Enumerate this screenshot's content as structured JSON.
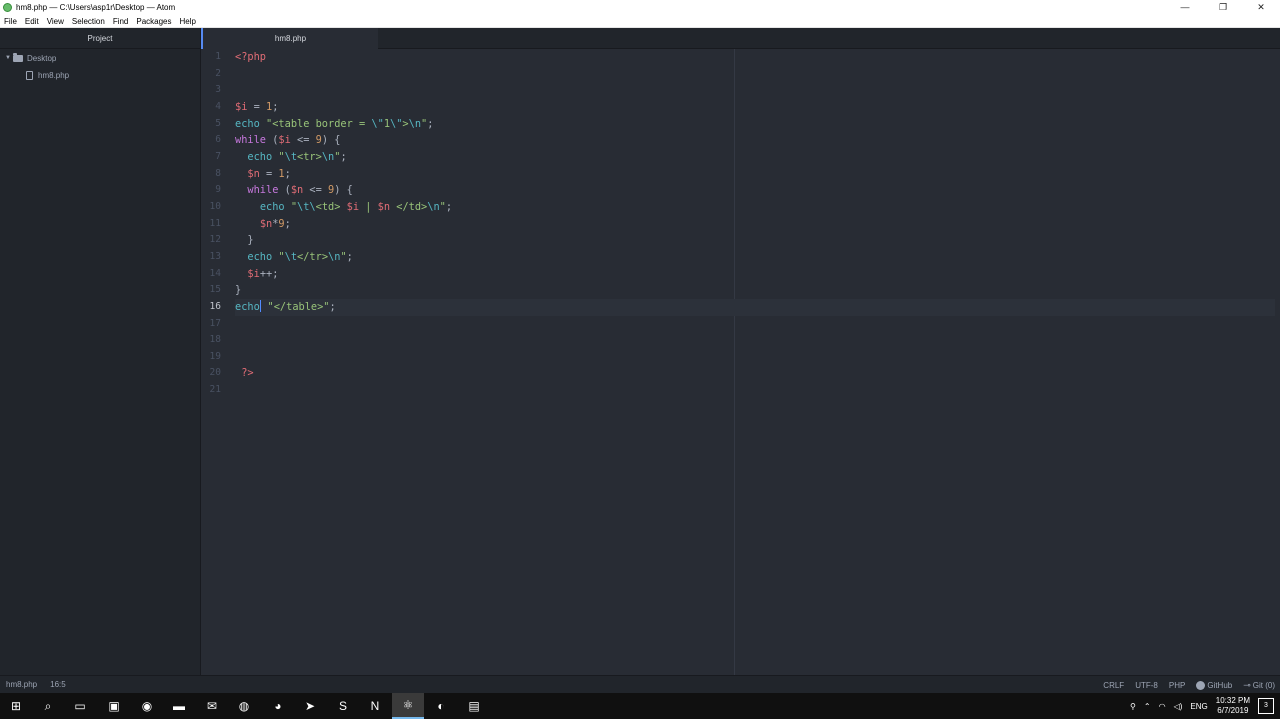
{
  "window": {
    "title": "hm8.php — C:\\Users\\asp1r\\Desktop — Atom",
    "controls": [
      "—",
      "❐",
      "✕"
    ]
  },
  "menu": [
    "File",
    "Edit",
    "View",
    "Selection",
    "Find",
    "Packages",
    "Help"
  ],
  "tree": {
    "header": "Project",
    "folder": "Desktop",
    "file": "hm8.php"
  },
  "tabs": [
    {
      "label": "hm8.php"
    }
  ],
  "editor": {
    "current_line": 16,
    "lines": [
      {
        "n": "1"
      },
      {
        "n": "2"
      },
      {
        "n": "3"
      },
      {
        "n": "4"
      },
      {
        "n": "5"
      },
      {
        "n": "6"
      },
      {
        "n": "7"
      },
      {
        "n": "8"
      },
      {
        "n": "9"
      },
      {
        "n": "10"
      },
      {
        "n": "11"
      },
      {
        "n": "12"
      },
      {
        "n": "13"
      },
      {
        "n": "14"
      },
      {
        "n": "15"
      },
      {
        "n": "16"
      },
      {
        "n": "17"
      },
      {
        "n": "18"
      },
      {
        "n": "19"
      },
      {
        "n": "20"
      },
      {
        "n": "21"
      }
    ],
    "code": [
      [
        {
          "t": "<?php",
          "c": "#e06c75"
        }
      ],
      [],
      [],
      [
        {
          "t": "$i",
          "c": "#e06c75"
        },
        {
          "t": " = ",
          "c": "#abb2bf"
        },
        {
          "t": "1",
          "c": "#d19a66"
        },
        {
          "t": ";",
          "c": "#abb2bf"
        }
      ],
      [
        {
          "t": "echo",
          "c": "#56b6c2"
        },
        {
          "t": " ",
          "c": "#abb2bf"
        },
        {
          "t": "\"<table border = ",
          "c": "#98c379"
        },
        {
          "t": "\\\"",
          "c": "#56b6c2"
        },
        {
          "t": "1",
          "c": "#98c379"
        },
        {
          "t": "\\\"",
          "c": "#56b6c2"
        },
        {
          "t": ">",
          "c": "#98c379"
        },
        {
          "t": "\\n",
          "c": "#56b6c2"
        },
        {
          "t": "\"",
          "c": "#98c379"
        },
        {
          "t": ";",
          "c": "#abb2bf"
        }
      ],
      [
        {
          "t": "while",
          "c": "#c678dd"
        },
        {
          "t": " (",
          "c": "#abb2bf"
        },
        {
          "t": "$i",
          "c": "#e06c75"
        },
        {
          "t": " <= ",
          "c": "#abb2bf"
        },
        {
          "t": "9",
          "c": "#d19a66"
        },
        {
          "t": ") {",
          "c": "#abb2bf"
        }
      ],
      [
        {
          "t": "  ",
          "c": "#abb2bf"
        },
        {
          "t": "echo",
          "c": "#56b6c2"
        },
        {
          "t": " ",
          "c": "#abb2bf"
        },
        {
          "t": "\"",
          "c": "#98c379"
        },
        {
          "t": "\\t",
          "c": "#56b6c2"
        },
        {
          "t": "<tr>",
          "c": "#98c379"
        },
        {
          "t": "\\n",
          "c": "#56b6c2"
        },
        {
          "t": "\"",
          "c": "#98c379"
        },
        {
          "t": ";",
          "c": "#abb2bf"
        }
      ],
      [
        {
          "t": "  ",
          "c": "#abb2bf"
        },
        {
          "t": "$n",
          "c": "#e06c75"
        },
        {
          "t": " = ",
          "c": "#abb2bf"
        },
        {
          "t": "1",
          "c": "#d19a66"
        },
        {
          "t": ";",
          "c": "#abb2bf"
        }
      ],
      [
        {
          "t": "  ",
          "c": "#abb2bf"
        },
        {
          "t": "while",
          "c": "#c678dd"
        },
        {
          "t": " (",
          "c": "#abb2bf"
        },
        {
          "t": "$n",
          "c": "#e06c75"
        },
        {
          "t": " <= ",
          "c": "#abb2bf"
        },
        {
          "t": "9",
          "c": "#d19a66"
        },
        {
          "t": ") {",
          "c": "#abb2bf"
        }
      ],
      [
        {
          "t": "    ",
          "c": "#abb2bf"
        },
        {
          "t": "echo",
          "c": "#56b6c2"
        },
        {
          "t": " ",
          "c": "#abb2bf"
        },
        {
          "t": "\"",
          "c": "#98c379"
        },
        {
          "t": "\\t\\",
          "c": "#56b6c2"
        },
        {
          "t": "<td> ",
          "c": "#98c379"
        },
        {
          "t": "$i",
          "c": "#e06c75"
        },
        {
          "t": " | ",
          "c": "#98c379"
        },
        {
          "t": "$n",
          "c": "#e06c75"
        },
        {
          "t": " </td>",
          "c": "#98c379"
        },
        {
          "t": "\\n",
          "c": "#56b6c2"
        },
        {
          "t": "\"",
          "c": "#98c379"
        },
        {
          "t": ";",
          "c": "#abb2bf"
        }
      ],
      [
        {
          "t": "    ",
          "c": "#abb2bf"
        },
        {
          "t": "$n",
          "c": "#e06c75"
        },
        {
          "t": "*",
          "c": "#abb2bf"
        },
        {
          "t": "9",
          "c": "#d19a66"
        },
        {
          "t": ";",
          "c": "#abb2bf"
        }
      ],
      [
        {
          "t": "  }",
          "c": "#abb2bf"
        }
      ],
      [
        {
          "t": "  ",
          "c": "#abb2bf"
        },
        {
          "t": "echo",
          "c": "#56b6c2"
        },
        {
          "t": " ",
          "c": "#abb2bf"
        },
        {
          "t": "\"",
          "c": "#98c379"
        },
        {
          "t": "\\t",
          "c": "#56b6c2"
        },
        {
          "t": "</tr>",
          "c": "#98c379"
        },
        {
          "t": "\\n",
          "c": "#56b6c2"
        },
        {
          "t": "\"",
          "c": "#98c379"
        },
        {
          "t": ";",
          "c": "#abb2bf"
        }
      ],
      [
        {
          "t": "  ",
          "c": "#abb2bf"
        },
        {
          "t": "$i",
          "c": "#e06c75"
        },
        {
          "t": "++;",
          "c": "#abb2bf"
        }
      ],
      [
        {
          "t": "}",
          "c": "#abb2bf"
        }
      ],
      [
        {
          "t": "echo",
          "c": "#56b6c2",
          "cursor": true
        },
        {
          "t": " ",
          "c": "#abb2bf"
        },
        {
          "t": "\"</table>\"",
          "c": "#98c379"
        },
        {
          "t": ";",
          "c": "#abb2bf"
        }
      ],
      [],
      [],
      [],
      [
        {
          "t": " ?>",
          "c": "#e06c75"
        }
      ],
      []
    ]
  },
  "status": {
    "file": "hm8.php",
    "cursor_pos": "16:5",
    "line_ending": "CRLF",
    "encoding": "UTF-8",
    "grammar": "PHP",
    "github": "GitHub",
    "git": "Git (0)"
  },
  "taskbar": {
    "icons": [
      {
        "name": "start-icon",
        "glyph": "⊞"
      },
      {
        "name": "search-icon",
        "glyph": "⌕"
      },
      {
        "name": "task-view-icon",
        "glyph": "▭"
      },
      {
        "name": "store-icon",
        "glyph": "▣"
      },
      {
        "name": "messenger-icon",
        "glyph": "◉"
      },
      {
        "name": "file-explorer-icon",
        "glyph": "▬"
      },
      {
        "name": "mail-icon",
        "glyph": "✉"
      },
      {
        "name": "chrome-icon",
        "glyph": "◍"
      },
      {
        "name": "discord-icon",
        "glyph": "◕"
      },
      {
        "name": "telegram-icon",
        "glyph": "➤"
      },
      {
        "name": "skype-icon",
        "glyph": "S"
      },
      {
        "name": "notion-icon",
        "glyph": "N"
      },
      {
        "name": "atom-icon",
        "glyph": "⚛"
      },
      {
        "name": "app-circle-icon",
        "glyph": "◐"
      },
      {
        "name": "clapper-icon",
        "glyph": "▤"
      }
    ],
    "active_index": 12,
    "tray": {
      "language": "ENG",
      "time": "10:32 PM",
      "date": "6/7/2019",
      "notifications": "3"
    }
  }
}
